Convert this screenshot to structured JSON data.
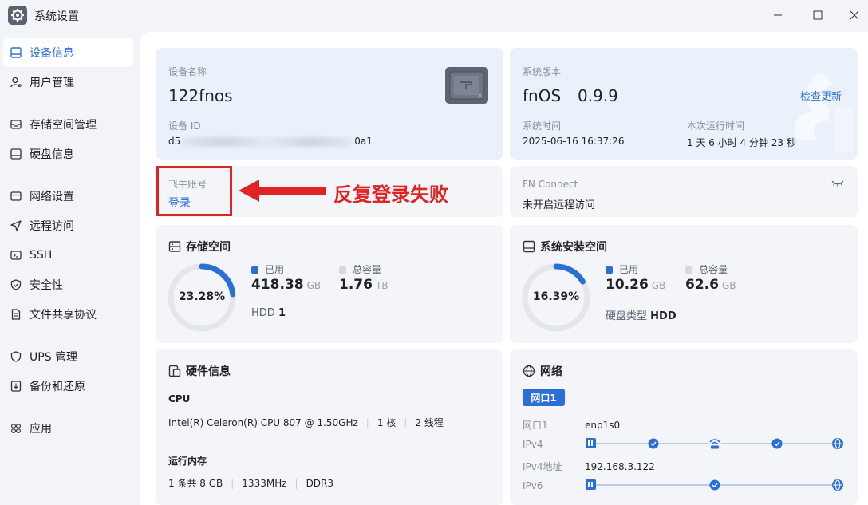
{
  "window": {
    "title": "系统设置"
  },
  "sidebar": {
    "items": [
      {
        "label": "设备信息",
        "icon": "device-info-icon"
      },
      {
        "label": "用户管理",
        "icon": "user-icon"
      },
      {
        "label": "存储空间管理",
        "icon": "storage-icon"
      },
      {
        "label": "硬盘信息",
        "icon": "disk-icon"
      },
      {
        "label": "网络设置",
        "icon": "network-icon"
      },
      {
        "label": "远程访问",
        "icon": "send-icon"
      },
      {
        "label": "SSH",
        "icon": "terminal-icon"
      },
      {
        "label": "安全性",
        "icon": "shield-icon"
      },
      {
        "label": "文件共享协议",
        "icon": "file-icon"
      },
      {
        "label": "UPS 管理",
        "icon": "ups-icon"
      },
      {
        "label": "备份和还原",
        "icon": "backup-icon"
      },
      {
        "label": "应用",
        "icon": "apps-icon"
      }
    ],
    "active_index": 0
  },
  "device": {
    "name_label": "设备名称",
    "name": "122fnos",
    "id_label": "设备 ID",
    "id_prefix": "d5",
    "id_suffix": "0a1"
  },
  "system": {
    "version_label": "系统版本",
    "os_name": "fnOS",
    "version": "0.9.9",
    "check_update": "检查更新",
    "time_label": "系统时间",
    "time": "2025-06-16 16:37:26",
    "uptime_label": "本次运行时间",
    "uptime": "1 天 6 小时 4 分钟 23 秒"
  },
  "account": {
    "label": "飞牛账号",
    "login": "登录"
  },
  "annotation": {
    "text": "反复登录失败",
    "color": "#e02424"
  },
  "fn_connect": {
    "label": "FN Connect",
    "status": "未开启远程访问"
  },
  "storage": {
    "title": "存储空间",
    "percent_text": "23.28%",
    "percent": 23.28,
    "used_label": "已用",
    "used_value": "418.38",
    "used_unit": "GB",
    "total_label": "总容量",
    "total_value": "1.76",
    "total_unit": "TB",
    "disk_type": "HDD",
    "disk_count": "1"
  },
  "system_space": {
    "title": "系统安装空间",
    "percent_text": "16.39%",
    "percent": 16.39,
    "used_label": "已用",
    "used_value": "10.26",
    "used_unit": "GB",
    "total_label": "总容量",
    "total_value": "62.6",
    "total_unit": "GB",
    "disk_type_label": "硬盘类型",
    "disk_type": "HDD"
  },
  "hardware": {
    "title": "硬件信息",
    "cpu_label": "CPU",
    "cpu_model": "Intel(R) Celeron(R) CPU 807 @ 1.50GHz",
    "cpu_cores": "1 核",
    "cpu_threads": "2 线程",
    "mem_label": "运行内存",
    "mem_slots": "1 条共 8 GB",
    "mem_freq": "1333MHz",
    "mem_type": "DDR3"
  },
  "network": {
    "title": "网络",
    "tab": "网口1",
    "rows": [
      {
        "key": "网口1",
        "value": "enp1s0"
      },
      {
        "key": "IPv4",
        "value": ""
      },
      {
        "key": "IPv4地址",
        "value": "192.168.3.122"
      },
      {
        "key": "IPv6",
        "value": ""
      }
    ]
  },
  "colors": {
    "accent": "#2a6ed7",
    "donut_track": "#e3e6eb",
    "legend_total": "#d6d9de"
  }
}
